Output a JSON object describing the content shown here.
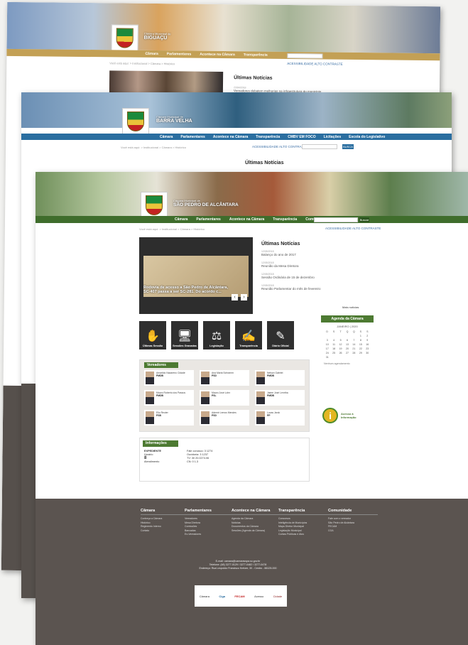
{
  "sheet1": {
    "brand": "BIGUAÇU",
    "brand_sub": "Câmara Municipal de",
    "nav": [
      "Câmara",
      "Parlamentares",
      "Acontece na Câmara",
      "Transparência"
    ],
    "breadcrumb": "Você está aqui: > Institucional > Câmara > Histórico",
    "tools": "ACESSIBILIDADE   ALTO CONTRASTE",
    "news_title": "Últimas Notícias",
    "news_date": "23/04/2018",
    "news_text": "Vereadores debatem melhorias na infraestrutura do município"
  },
  "sheet2": {
    "brand": "BARRA VELHA",
    "brand_sub": "Câmara Municipal de",
    "nav": [
      "Câmara",
      "Parlamentares",
      "Acontece na Câmara",
      "Transparência",
      "CMBV EM FOCO",
      "Licitações",
      "Escola do Legislativo"
    ],
    "breadcrumb": "Você está aqui: > Institucional > Câmara > Histórico",
    "tools": "ACESSIBILIDADE   ALTO CONTRASTE",
    "search_btn": "BUSCA",
    "news_title": "Últimas Notícias"
  },
  "sheet3": {
    "brand": "SÃO PEDRO DE ALCÂNTARA",
    "brand_sub": "Câmara Municipal de",
    "nav": [
      "Câmara",
      "Parlamentares",
      "Acontece na Câmara",
      "Transparência",
      "Comunidade"
    ],
    "search_btn": "Buscar",
    "breadcrumb": "Você está aqui: > Institucional > Câmara > Histórico",
    "tools": "ACESSIBILIDADE   ALTO CONTRASTE",
    "slider_caption": "Rodovia de acesso a São Pedro de Alcântara, SC-407 passa a ser SC-281. Do acordo c...",
    "news_title": "Últimas Notícias",
    "news": [
      {
        "date": "12/05/2018",
        "text": "Balanço do ano de 2017"
      },
      {
        "date": "12/05/2018",
        "text": "Reunião da Mesa Diretora"
      },
      {
        "date": "12/05/2018",
        "text": "Sessão Ordinária de 15 de dezembro"
      },
      {
        "date": "12/05/2018",
        "text": "Reunião Parlamentar do mês de fevereiro"
      }
    ],
    "more_news": "Mais notícias",
    "quick": [
      {
        "icon": "✋",
        "label": "Últimas Sessão"
      },
      {
        "icon": "🖥",
        "label": "Sessões Gravadas"
      },
      {
        "icon": "⚖",
        "label": "Legislação"
      },
      {
        "icon": "✍",
        "label": "Transparência"
      },
      {
        "icon": "✎",
        "label": "Diário Oficial"
      }
    ],
    "vereadores_title": "Vereadores",
    "vereadores": [
      {
        "name": "Amarildo Nazareno Cidade",
        "party": "PMDB"
      },
      {
        "name": "Ana Maria Schramm",
        "party": "PSD"
      },
      {
        "name": "Nelson Gabriel",
        "party": "PMDB"
      },
      {
        "name": "Mauro Roberto dos Passos",
        "party": "PMDB"
      },
      {
        "name": "Mauro José Lohn",
        "party": "PSL"
      },
      {
        "name": "Jaime José Lenrtha",
        "party": "PMDB"
      },
      {
        "name": "Elio Reuter",
        "party": "PSB"
      },
      {
        "name": "Ademir Lemos Mendes",
        "party": "PSD"
      },
      {
        "name": "Lucas Jarck",
        "party": "PP"
      }
    ],
    "info_title": "Informações",
    "info_left": [
      "EXPEDIENTE",
      "Horário",
      "8",
      "Atendimento"
    ],
    "info_right": [
      "Fale conosco: 3 1274",
      "Ouvidoria: 3 1237",
      "TV: 30 20.0274.06",
      "CN: 0 1.3"
    ],
    "agenda_title": "Agenda da Câmara",
    "agenda_month": "JANEIRO | 2020",
    "agenda_days": [
      "D",
      "S",
      "T",
      "Q",
      "Q",
      "S",
      "S"
    ],
    "agenda_weeks": [
      [
        "",
        "",
        "",
        "",
        "",
        "1",
        "2"
      ],
      [
        "3",
        "4",
        "5",
        "6",
        "7",
        "8",
        "9"
      ],
      [
        "10",
        "11",
        "12",
        "13",
        "14",
        "15",
        "16"
      ],
      [
        "17",
        "18",
        "19",
        "20",
        "21",
        "22",
        "23"
      ],
      [
        "24",
        "25",
        "26",
        "27",
        "28",
        "29",
        "30"
      ],
      [
        "31",
        "",
        "",
        "",
        "",
        "",
        ""
      ]
    ],
    "agenda_note": "Nenhum agendamento",
    "info_badge": "Acesso à Informação",
    "footer_cols": [
      {
        "title": "Câmara",
        "links": [
          "Conheça a Câmara",
          "Histórico",
          "Regimento Interno",
          "Contato"
        ]
      },
      {
        "title": "Parlamentares",
        "links": [
          "Vereadores",
          "Mesa Diretora",
          "Comissões",
          "Bancadas",
          "Ex-Vereadores"
        ]
      },
      {
        "title": "Acontece na Câmara",
        "links": [
          "Agenda da Câmara",
          "Notícias",
          "Documentos da Câmara",
          "Sessões (Agenda da Câmara)"
        ]
      },
      {
        "title": "Transparência",
        "links": [
          "Concursos",
          "Inteligência de Municípios",
          "Mapa Diretor Municipal",
          "Legislação Municipal",
          "Contas Públicas e Atos"
        ]
      },
      {
        "title": "Comunidade",
        "links": [
          "Fale com o vereador",
          "São Pedro de Alcântara",
          "FECAM",
          "CGA"
        ]
      }
    ],
    "contact_lines": [
      "E-mail: camara@camarasspa.sc.gov.br",
      "Telefone: (48) 3277-0129 / 3277-0482 / 3277-0478",
      "Endereço: Rua Leopoldo Francisco Kretzer, 30 - Centro - 88125-000"
    ],
    "sponsors": [
      "Câmara",
      "Ciga",
      "FECAM",
      "Acesso",
      "Cidade"
    ]
  }
}
